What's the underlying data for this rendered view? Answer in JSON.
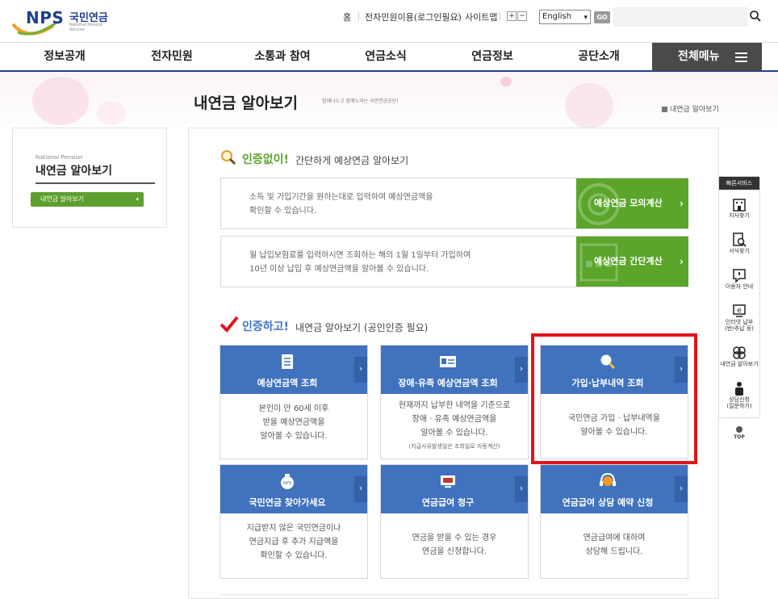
{
  "logo": {
    "brand": "NPS",
    "name_kr": "국민연금",
    "name_en": "National Pension Service"
  },
  "utility": {
    "home": "홈",
    "e_service": "전자민원이용(로그인필요)",
    "sitemap": "사이트맵",
    "zoom_in": "+",
    "zoom_out": "−",
    "language_selected": "English",
    "go": "GO",
    "search_placeholder": ""
  },
  "nav": {
    "items": [
      "정보공개",
      "전자민원",
      "소통과 참여",
      "연금소식",
      "연금정보",
      "공단소개"
    ],
    "all_menu": "전체메뉴"
  },
  "hero": {
    "title": "내연금 알아보기",
    "subtitle": "함께나누고 함께누리는 국민연금공단!",
    "breadcrumb": "내연금 알아보기"
  },
  "sidebar": {
    "en_label": "National Pension",
    "title": "내연금 알아보기",
    "menu_selected": "내연금 알아보기"
  },
  "section1": {
    "highlight": "인증없이!",
    "desc": "간단하게 예상연금 알아보기",
    "boxes": [
      {
        "line1": "소득 및 가입기간을 원하는대로 입력하여 예상연금액을",
        "line2": "확인할 수 있습니다.",
        "button": "예상연금 모의계산"
      },
      {
        "line1": "월 납입보험료를 입력하시면 조회하는 해의 1월 1일부터 가입하여",
        "line2": "10년 이상 납입 후 예상연금액을 알아볼 수 있습니다.",
        "button": "예상연금 간단계산"
      }
    ]
  },
  "section2": {
    "highlight": "인증하고!",
    "desc": "내연금 알아보기 (공인인증 필요)",
    "cards": [
      {
        "title": "예상연금액 조회",
        "lines": [
          "본인이 만 60세 이후",
          "받을 예상연금액을",
          "알아볼 수 있습니다."
        ],
        "note": ""
      },
      {
        "title": "장애·유족 예상연금액 조회",
        "lines": [
          "현재까지 납부한 내역을 기준으로",
          "장애 · 유족 예상연금액을",
          "알아볼 수 있습니다."
        ],
        "note": "(지급사유발생일은 조회일로 자동계산)"
      },
      {
        "title": "가입·납부내역 조회",
        "lines": [
          "국민연금 가입 · 납부내역을",
          "알아볼 수 있습니다."
        ],
        "note": ""
      },
      {
        "title": "국민연금 찾아가세요",
        "lines": [
          "지급받지 않은 국민연금이나",
          "연금지급 후 추가 지급액을",
          "확인할 수 있습니다."
        ],
        "note": ""
      },
      {
        "title": "연금급여 청구",
        "lines": [
          "연금을 받을 수 있는 경우",
          "연금을 신청합니다."
        ],
        "note": ""
      },
      {
        "title": "연금급여 상담 예약 신청",
        "lines": [
          "연금급여에 대하여",
          "상담해 드립니다."
        ],
        "note": ""
      }
    ]
  },
  "quick_service": {
    "title": "빠른서비스",
    "items": [
      "지사찾기",
      "서식찾기",
      "이용자 안내",
      "인터넷 납부",
      "(반/추납 등)",
      "내연금 알아보기",
      "상담신청",
      "(질문하기)"
    ],
    "top": "TOP"
  },
  "colors": {
    "brand_blue": "#1f3f8f",
    "card_blue": "#4072be",
    "green": "#5aa52a",
    "highlight_red": "#e3131b"
  }
}
